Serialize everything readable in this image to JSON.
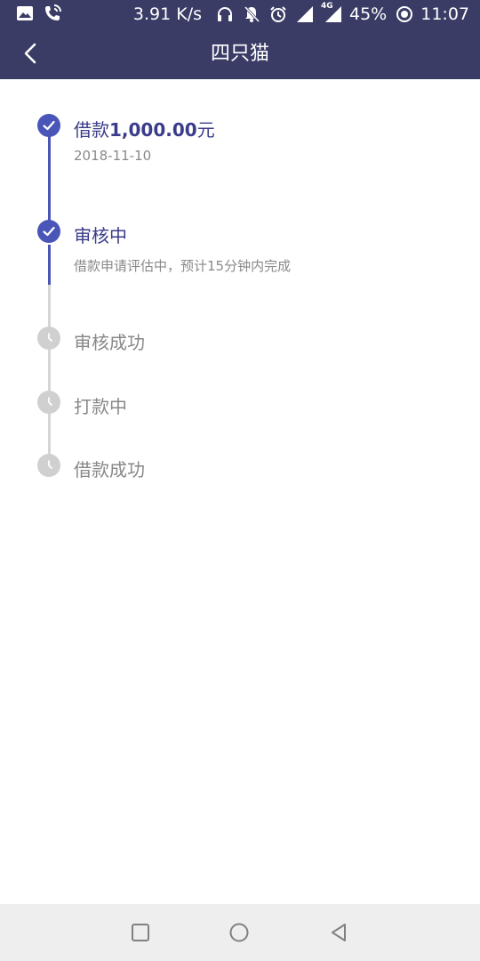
{
  "status_bar": {
    "net_speed": "3.91 K/s",
    "battery_percent": "45%",
    "time": "11:07",
    "network_label": "4G",
    "icons": [
      "image-icon",
      "phone-call-icon",
      "headphones-icon",
      "bell-off-icon",
      "alarm-icon",
      "signal-icon",
      "signal-4g-icon",
      "battery-saver-icon"
    ]
  },
  "header": {
    "title": "四只猫",
    "back_icon": "back-arrow-icon"
  },
  "timeline": {
    "steps": [
      {
        "status": "done",
        "title_prefix": "借款",
        "title_amount": "1,000.00",
        "title_suffix": "元",
        "subtitle": "2018-11-10"
      },
      {
        "status": "done",
        "title": "审核中",
        "subtitle": "借款申请评估中，预计15分钟内完成"
      },
      {
        "status": "pending",
        "title": "审核成功"
      },
      {
        "status": "pending",
        "title": "打款中"
      },
      {
        "status": "pending",
        "title": "借款成功"
      }
    ],
    "colors": {
      "active": "#4a55b8",
      "pending": "#d0d0d0",
      "header": "#3a3c66"
    }
  },
  "nav_bar": {
    "icons": [
      "recent-apps-icon",
      "home-icon",
      "back-triangle-icon"
    ]
  }
}
